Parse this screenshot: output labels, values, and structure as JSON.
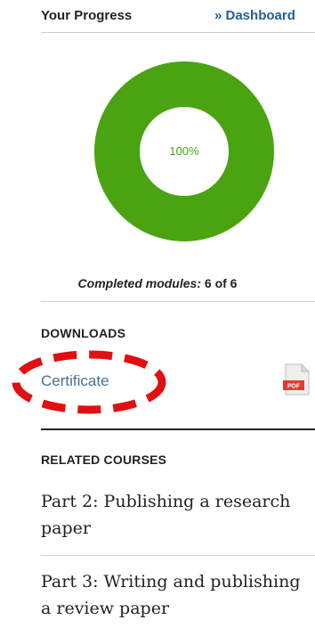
{
  "progress": {
    "title": "Your Progress",
    "dashboard_link": "» Dashboard",
    "percent_label": "100%",
    "percent_value": 100,
    "completed_label": "Completed modules:",
    "completed_value": "6 of 6",
    "ring_color": "#4aa310"
  },
  "downloads": {
    "title": "DOWNLOADS",
    "certificate_label": "Certificate",
    "file_icon": "pdf-file-icon",
    "file_icon_text": "PDF"
  },
  "related": {
    "title": "RELATED COURSES",
    "courses": [
      "Part 2: Publishing a research paper",
      "Part 3: Writing and publishing a review paper"
    ]
  },
  "colors": {
    "accent_link": "#1f5f9e",
    "highlight": "#e01010"
  }
}
